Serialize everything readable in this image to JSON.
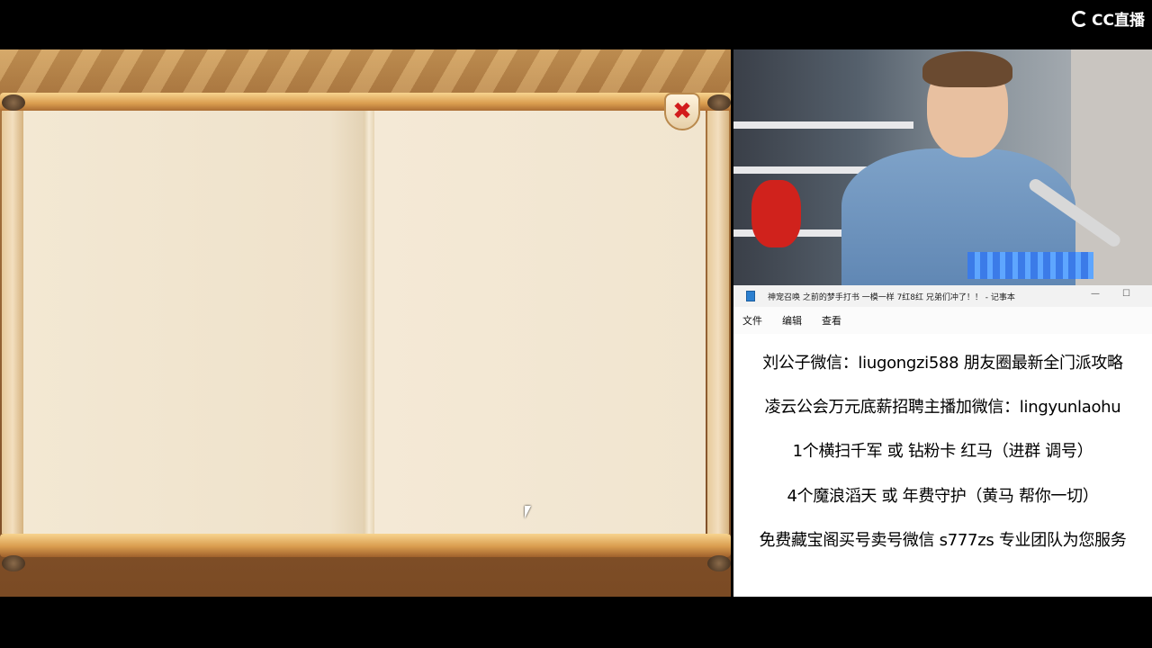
{
  "brand": {
    "logo_text": "CC直播",
    "icon": "cc-logo-icon"
  },
  "game": {
    "close_icon": "close-icon",
    "close_glyph": "✖",
    "accent_color": "#d21c1c"
  },
  "notepad": {
    "title": "神宠召唤 之前的梦手打书 一模一样 7红8红 兄弟们冲了！！ - 记事本",
    "minimize_glyph": "—",
    "maximize_glyph": "☐",
    "menu": [
      {
        "label": "文件"
      },
      {
        "label": "编辑"
      },
      {
        "label": "查看"
      }
    ],
    "lines": [
      "刘公子微信：liugongzi588 朋友圈最新全门派攻略",
      "凌云公会万元底薪招聘主播加微信：lingyunlaohu",
      "1个横扫千军 或 钻粉卡 红马（进群 调号）",
      "4个魔浪滔天 或 年费守护（黄马 帮你一切）",
      "免费藏宝阁买号卖号微信 s777zs 专业团队为您服务"
    ]
  }
}
